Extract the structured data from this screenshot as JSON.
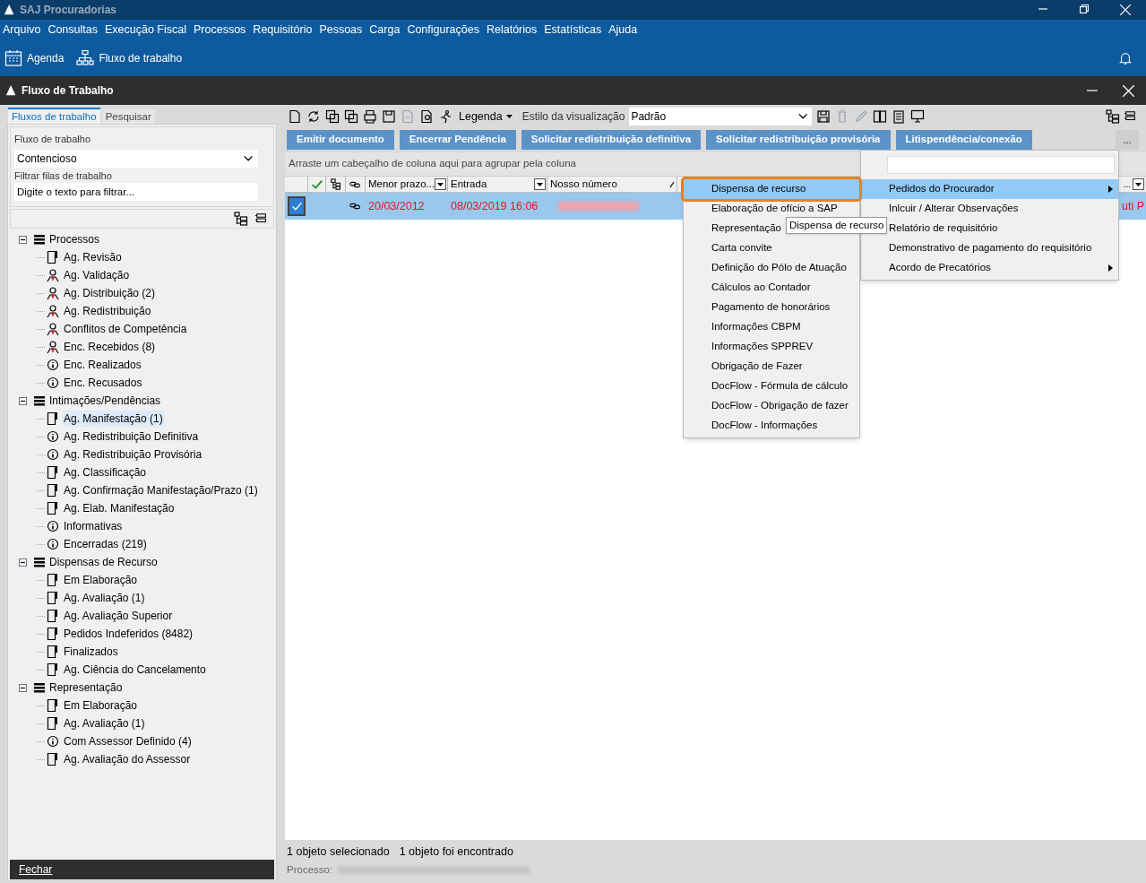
{
  "app_title": "SAJ Procuradorias",
  "menu": [
    "Arquivo",
    "Consultas",
    "Execução Fiscal",
    "Processos",
    "Requisitório",
    "Pessoas",
    "Carga",
    "Configurações",
    "Relatórios",
    "Estatísticas",
    "Ajuda"
  ],
  "quick_launch": [
    {
      "label": "Agenda",
      "kind": "calendar"
    },
    {
      "label": "Fluxo de trabalho",
      "kind": "flow"
    }
  ],
  "window_title": "Fluxo de Trabalho",
  "left_tabs": [
    {
      "label": "Fluxos de trabalho",
      "selected": true
    },
    {
      "label": "Pesquisar",
      "selected": false
    }
  ],
  "workflow_label": "Fluxo de trabalho",
  "workflow_value": "Contencioso",
  "filter_label": "Filtrar filas de trabalho",
  "filter_placeholder": "Digite o texto para filtrar...",
  "tree": [
    {
      "label": "Processos",
      "expanded": true,
      "children": [
        {
          "label": "Ag. Revisão",
          "kind": "doc",
          "selected": false
        },
        {
          "label": "Ag. Validação",
          "kind": "person",
          "selected": false
        },
        {
          "label": "Ag. Distribuição (2)",
          "kind": "person",
          "selected": false
        },
        {
          "label": "Ag. Redistribuição",
          "kind": "person",
          "selected": false
        },
        {
          "label": "Conflitos de Competência",
          "kind": "person",
          "selected": false
        },
        {
          "label": "Enc. Recebidos (8)",
          "kind": "person",
          "selected": false
        },
        {
          "label": "Enc. Realizados",
          "kind": "info",
          "selected": false
        },
        {
          "label": "Enc. Recusados",
          "kind": "info",
          "selected": false
        }
      ]
    },
    {
      "label": "Intimações/Pendências",
      "expanded": true,
      "children": [
        {
          "label": "Ag. Manifestação (1)",
          "kind": "doc",
          "selected": true
        },
        {
          "label": "Ag. Redistribuição Definitiva",
          "kind": "info",
          "selected": false
        },
        {
          "label": "Ag. Redistribuição Provisória",
          "kind": "info",
          "selected": false
        },
        {
          "label": "Ag. Classificação",
          "kind": "doc",
          "selected": false
        },
        {
          "label": "Ag. Confirmação Manifestação/Prazo (1)",
          "kind": "doc",
          "selected": false
        },
        {
          "label": "Ag. Elab. Manifestação",
          "kind": "doc",
          "selected": false
        },
        {
          "label": "Informativas",
          "kind": "info",
          "selected": false
        },
        {
          "label": "Encerradas (219)",
          "kind": "info",
          "selected": false
        }
      ]
    },
    {
      "label": "Dispensas de Recurso",
      "expanded": true,
      "children": [
        {
          "label": "Em Elaboração",
          "kind": "doc",
          "selected": false
        },
        {
          "label": "Ag. Avaliação (1)",
          "kind": "doc",
          "selected": false
        },
        {
          "label": "Ag. Avaliação Superior",
          "kind": "doc",
          "selected": false
        },
        {
          "label": "Pedidos Indeferidos (8482)",
          "kind": "doc",
          "selected": false
        },
        {
          "label": "Finalizados",
          "kind": "doc",
          "selected": false
        },
        {
          "label": "Ag. Ciência do Cancelamento",
          "kind": "doc",
          "selected": false
        }
      ]
    },
    {
      "label": "Representação",
      "expanded": true,
      "children": [
        {
          "label": "Em Elaboração",
          "kind": "doc",
          "selected": false
        },
        {
          "label": "Ag. Avaliação (1)",
          "kind": "doc",
          "selected": false
        },
        {
          "label": "Com Assessor Definido (4)",
          "kind": "info",
          "selected": false
        },
        {
          "label": "Ag. Avaliação do Assessor",
          "kind": "doc",
          "selected": false
        }
      ]
    }
  ],
  "close_button": "Fechar",
  "legend_button": "Legenda",
  "view_style_label": "Estilo da visualização",
  "view_style_value": "Padrão",
  "action_buttons": [
    "Emitir documento",
    "Encerrar Pendência",
    "Solicitar redistribuição definitiva",
    "Solicitar redistribuição provisória",
    "Litispendência/conexão"
  ],
  "more_button": "...",
  "group_hint": "Arraste um cabeçalho de coluna aqui para agrupar pela coluna",
  "columns": [
    "Menor prazo...",
    "Entrada",
    "Nosso número"
  ],
  "column_cut": "...",
  "rows": [
    {
      "checked": true,
      "selected": true,
      "menor_prazo": "20/03/2012",
      "entrada": "08/03/2019 16:06",
      "cut_cell": "uti P"
    }
  ],
  "context_menu": [
    {
      "label": "Pedidos do Procurador",
      "selected": true,
      "submenu": true
    },
    {
      "label": "Inlcuir / Alterar Observações",
      "selected": false,
      "submenu": false
    },
    {
      "label": "Relatório de requisitório",
      "selected": false,
      "submenu": false
    },
    {
      "label": "Demonstrativo de pagamento do requisitório",
      "selected": false,
      "submenu": false
    },
    {
      "label": "Acordo de Precatórios",
      "selected": false,
      "submenu": true
    }
  ],
  "submenu": [
    {
      "label": "Dispensa de recurso",
      "selected": true
    },
    {
      "label": "Elaboração de ofício a SAP",
      "selected": false
    },
    {
      "label": "Representação",
      "selected": false
    },
    {
      "label": "Carta convite",
      "selected": false
    },
    {
      "label": "Definição do Pólo de Atuação",
      "selected": false
    },
    {
      "label": "Cálculos ao Contador",
      "selected": false
    },
    {
      "label": "Pagamento de honorários",
      "selected": false
    },
    {
      "label": "Informações CBPM",
      "selected": false
    },
    {
      "label": "Informações SPPREV",
      "selected": false
    },
    {
      "label": "Obrigação de Fazer",
      "selected": false
    },
    {
      "label": "DocFlow - Fórmula de cálculo",
      "selected": false
    },
    {
      "label": "DocFlow - Obrigação de fazer",
      "selected": false
    },
    {
      "label": "DocFlow - Informações",
      "selected": false
    }
  ],
  "tooltip": "Dispensa de recurso",
  "status": [
    "1 objeto selecionado",
    "1 objeto foi encontrado"
  ],
  "process_label": "Processo:"
}
